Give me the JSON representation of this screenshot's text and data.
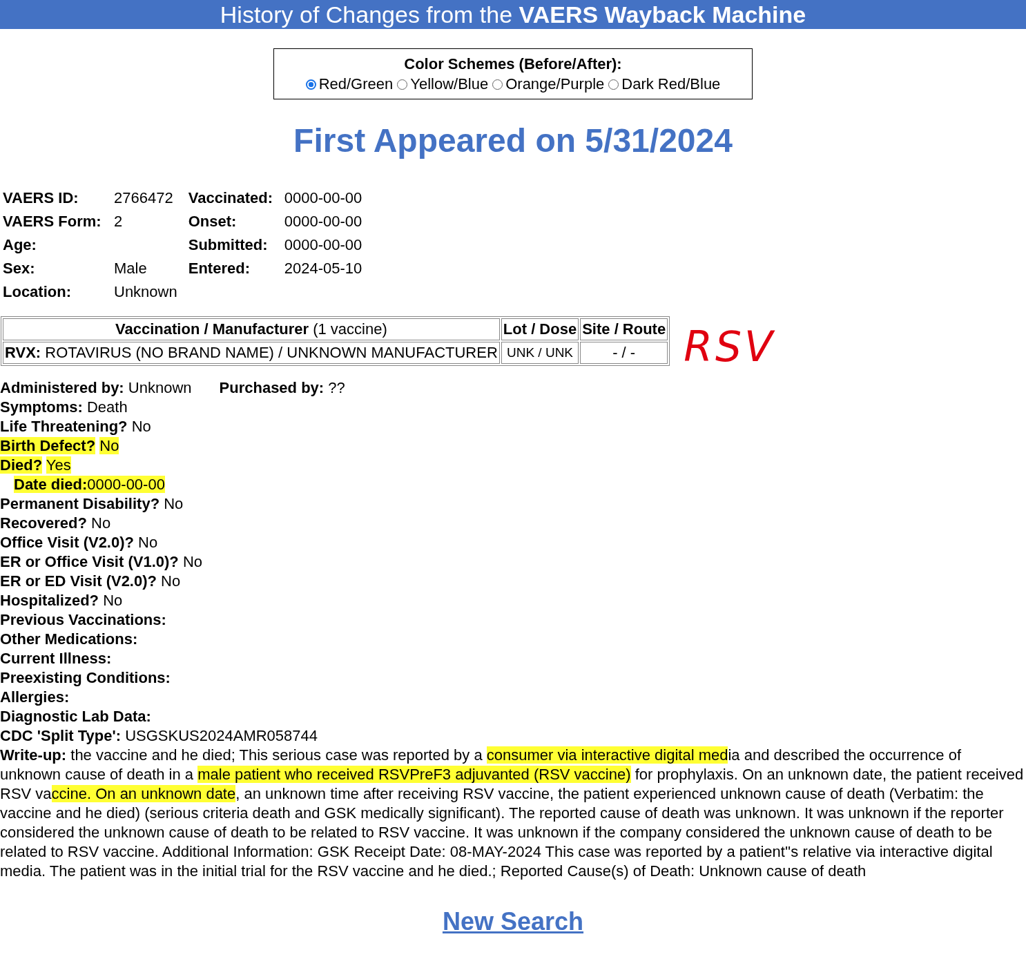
{
  "banner": {
    "title": "History of Changes from the **VAERS Wayback Machine**"
  },
  "color_schemes": {
    "title": "Color Schemes (Before/After):",
    "options": [
      {
        "label": "Red/Green",
        "selected": true
      },
      {
        "label": "Yellow/Blue",
        "selected": false
      },
      {
        "label": "Orange/Purple",
        "selected": false
      },
      {
        "label": "Dark Red/Blue",
        "selected": false
      }
    ]
  },
  "heading": "First Appeared on 5/31/2024",
  "info_left": [
    {
      "label": "VAERS ID:",
      "value": "2766472"
    },
    {
      "label": "VAERS Form:",
      "value": "2"
    },
    {
      "label": "Age:"
    },
    {
      "label": "Sex:",
      "value": "Male"
    },
    {
      "label": "Location:",
      "value": "Unknown"
    }
  ],
  "info_right": [
    {
      "label": "Vaccinated:",
      "value": "0000-00-00"
    },
    {
      "label": "Onset:",
      "value": "0000-00-00"
    },
    {
      "label": "Submitted:",
      "value": "0000-00-00"
    },
    {
      "label": "Entered:",
      "value": "2024-05-10"
    }
  ],
  "vaccine_table": {
    "columns": [
      "**Vaccination / Manufacturer** (1 vaccine)",
      "Lot / Dose",
      "Site / Route"
    ],
    "rows": [
      [
        "**RVX:** ROTAVIRUS (NO BRAND NAME) / UNKNOWN MANUFACTURER",
        "UNK / UNK",
        "- / -"
      ]
    ]
  },
  "handwritten_note": "RSV",
  "administration": [
    {
      "label": "Administered by:",
      "value": "Unknown"
    },
    {
      "label": "Purchased by:",
      "value": "??"
    }
  ],
  "fields": [
    {
      "label": "Symptoms:",
      "value": "Death",
      "highlighted": false
    },
    {
      "label": "Life Threatening?",
      "value": "No",
      "highlighted": false
    },
    {
      "label": "Birth Defect?",
      "value": "No",
      "highlighted": true
    },
    {
      "label": "Died?",
      "value": "Yes",
      "highlighted": true,
      "children": [
        {
          "label": "Date died:",
          "value": "0000-00-00",
          "highlighted": true
        }
      ]
    },
    {
      "label": "Permanent Disability?",
      "value": "No",
      "highlighted": false
    },
    {
      "label": "Recovered?",
      "value": "No",
      "highlighted": false
    },
    {
      "label": "Office Visit (V2.0)?",
      "value": "No",
      "highlighted": false
    },
    {
      "label": "ER or Office Visit (V1.0)?",
      "value": "No",
      "highlighted": false
    },
    {
      "label": "ER or ED Visit (V2.0)?",
      "value": "No",
      "highlighted": false
    },
    {
      "label": "Hospitalized?",
      "value": "No",
      "highlighted": false
    },
    {
      "label": "Previous Vaccinations:",
      "highlighted": false
    },
    {
      "label": "Other Medications:",
      "highlighted": false
    },
    {
      "label": "Current Illness:",
      "highlighted": false
    },
    {
      "label": "Preexisting Conditions:",
      "highlighted": false
    },
    {
      "label": "Allergies:",
      "highlighted": false
    },
    {
      "label": "Diagnostic Lab Data:",
      "highlighted": false
    },
    {
      "label": "CDC 'Split Type':",
      "value": "USGSKUS2024AMR058744",
      "highlighted": false
    }
  ],
  "writeup": {
    "label": "Write-up:",
    "segments": [
      {
        "text": "the vaccine and he died; This serious case was reported by a ",
        "highlighted": false
      },
      {
        "text": "consumer via interactive digital med",
        "highlighted": true
      },
      {
        "text": "ia and described the occurrence of unknown cause of death in a ",
        "highlighted": false
      },
      {
        "text": "male patient who received RSVPreF3 adjuvanted (RSV vaccine)",
        "highlighted": true
      },
      {
        "text": " for prophylaxis. On an unknown date, the patient received RSV va",
        "highlighted": false
      },
      {
        "text": "ccine. On an unknown date",
        "highlighted": true
      },
      {
        "text": ", an unknown time after receiving RSV vaccine, the patient experienced unknown cause of death (Verbatim: the vaccine and he died) (serious criteria death and GSK medically significant). The reported cause of death was unknown. It was unknown if the reporter considered the unknown cause of death to be related to RSV vaccine. It was unknown if the company considered the unknown cause of death to be related to RSV vaccine. Additional Information: GSK Receipt Date: 08-MAY-2024 This case was reported by a patient''s relative via interactive digital media. The patient was in the initial trial for the RSV vaccine and he died.; Reported Cause(s) of Death: Unknown cause of death",
        "highlighted": false
      }
    ]
  },
  "new_search": "New Search"
}
